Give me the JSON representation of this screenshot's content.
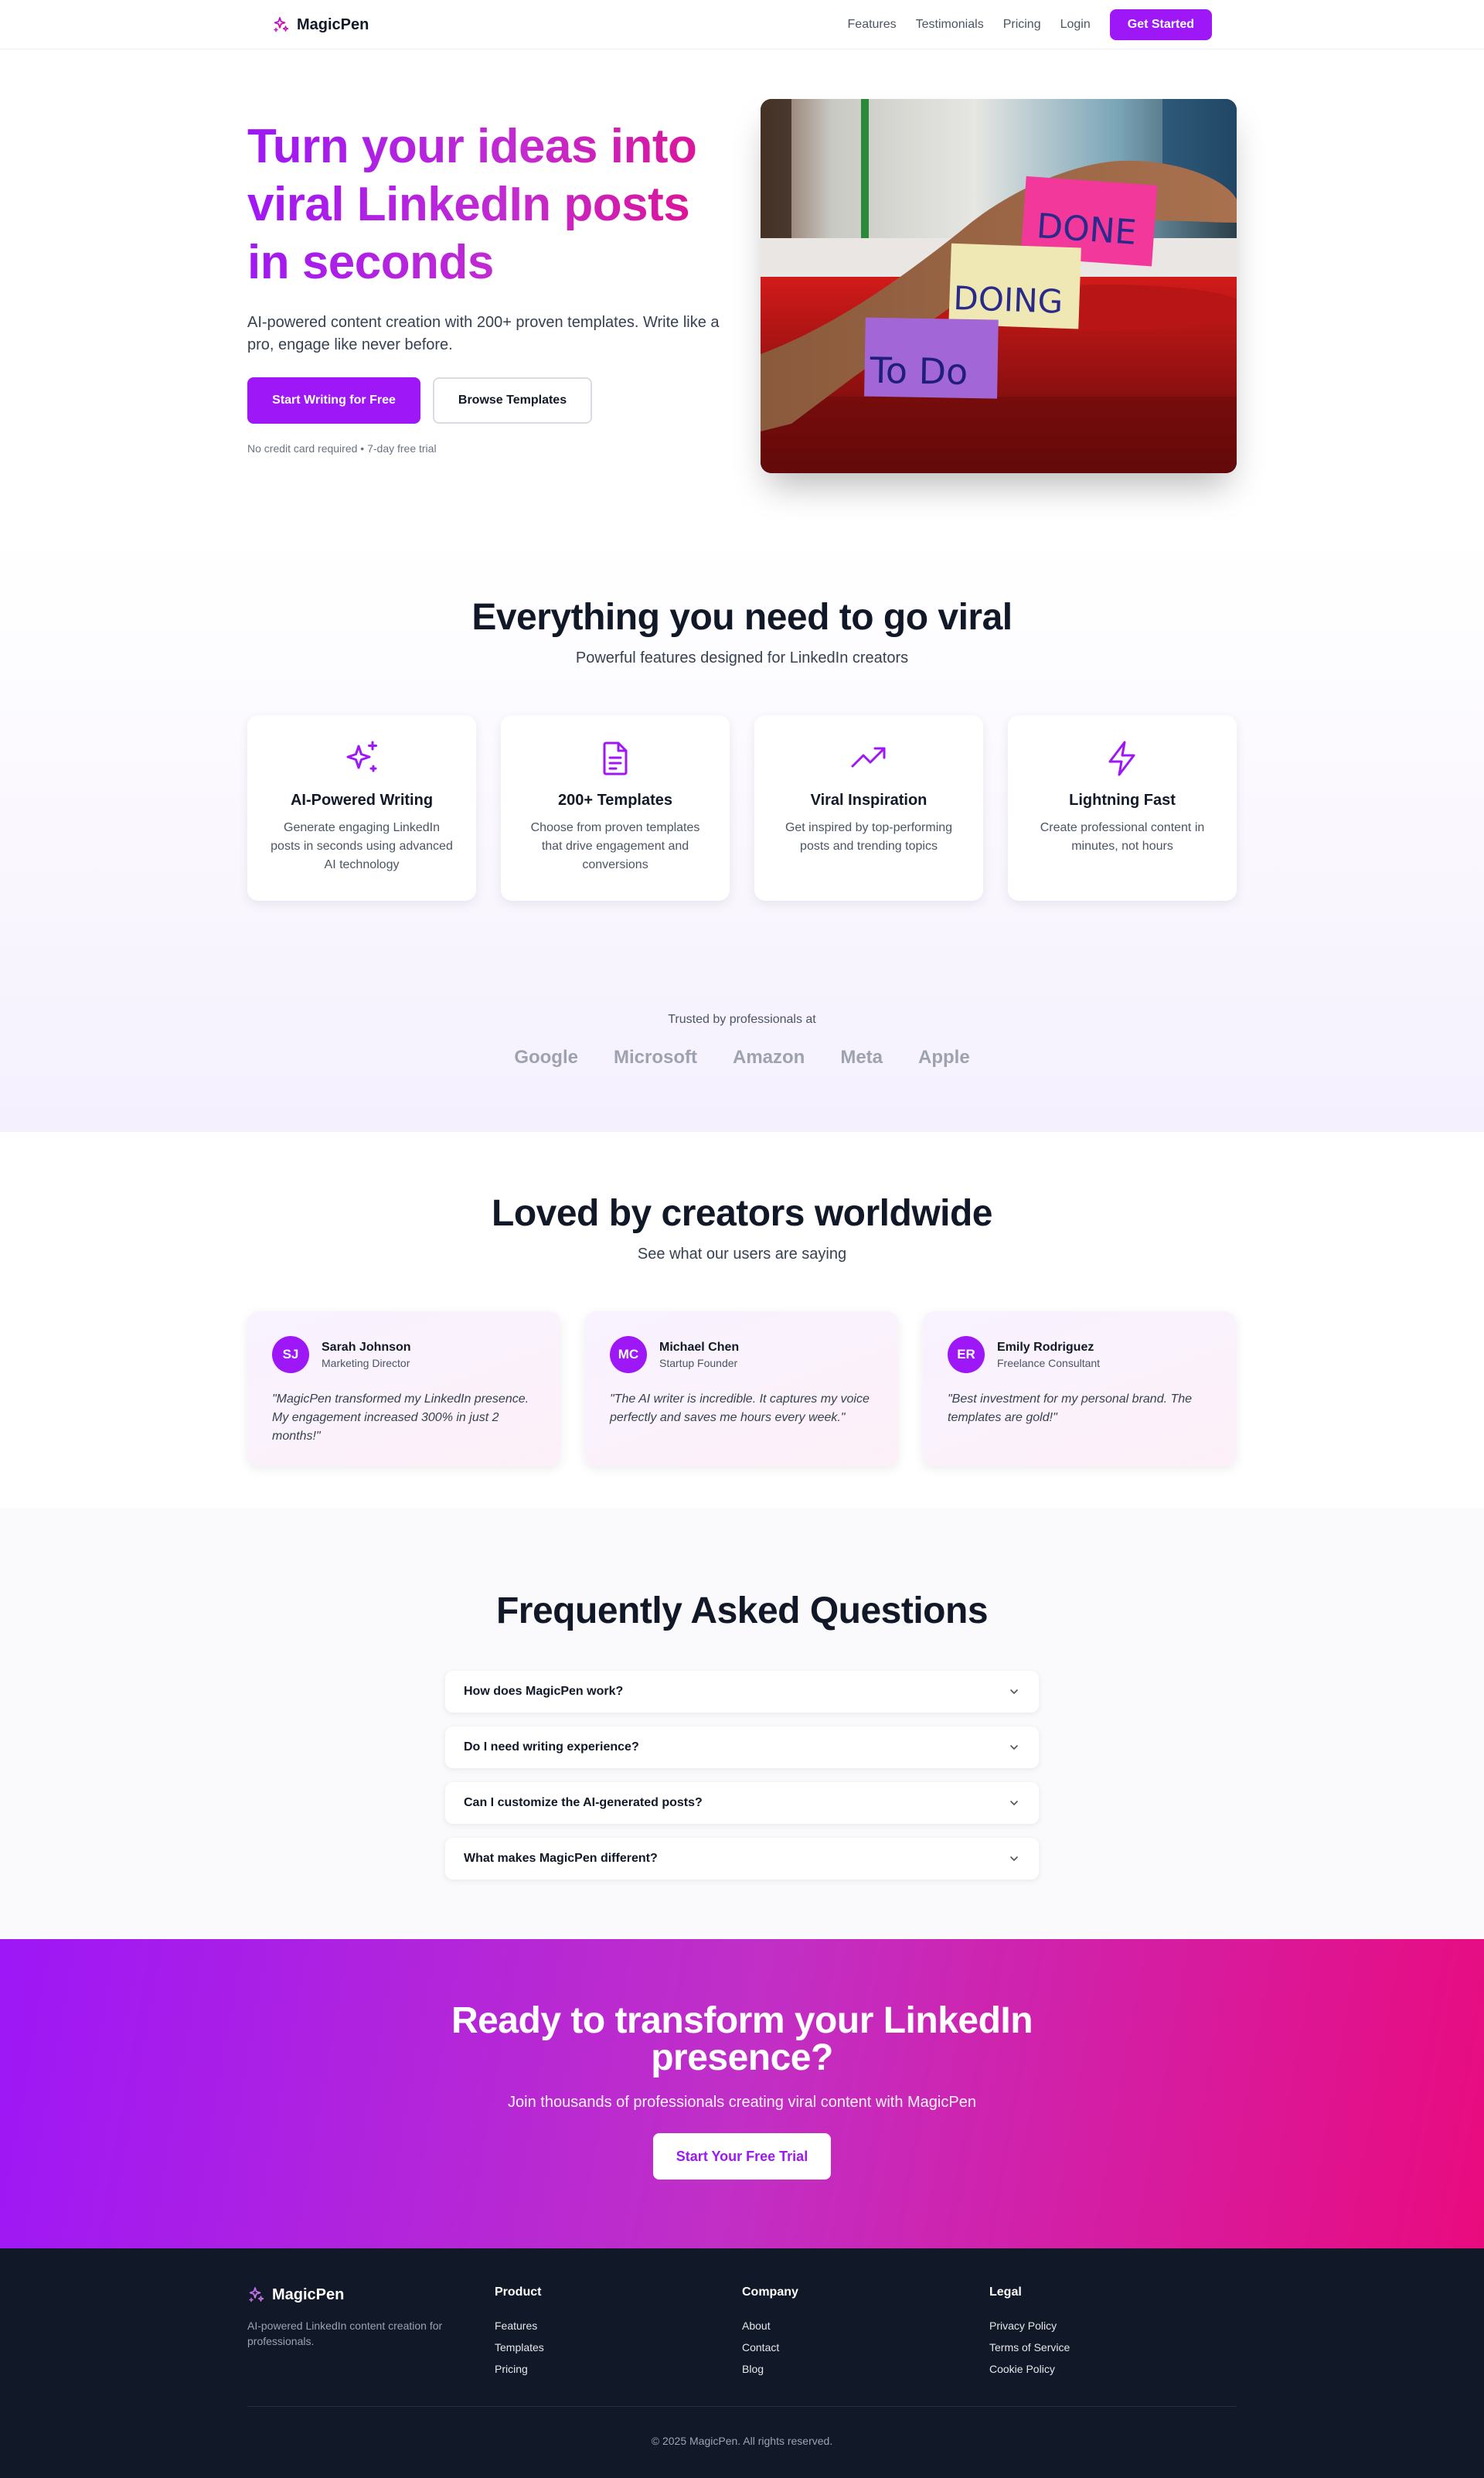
{
  "nav": {
    "brand": "MagicPen",
    "links": [
      "Features",
      "Testimonials",
      "Pricing",
      "Login"
    ],
    "cta": "Get Started"
  },
  "hero": {
    "title": "Turn your ideas into viral LinkedIn posts in seconds",
    "subtitle": "AI-powered content creation with 200+ proven templates. Write like a pro, engage like never before.",
    "primary_button": "Start Writing for Free",
    "secondary_button": "Browse Templates",
    "note": "No credit card required • 7-day free trial",
    "image_notes": [
      "Done",
      "Doing",
      "To Do"
    ]
  },
  "features": {
    "title": "Everything you need to go viral",
    "subtitle": "Powerful features designed for LinkedIn creators",
    "items": [
      {
        "icon": "sparkles-icon",
        "title": "AI-Powered Writing",
        "desc": "Generate engaging LinkedIn posts in seconds using advanced AI technology"
      },
      {
        "icon": "document-icon",
        "title": "200+ Templates",
        "desc": "Choose from proven templates that drive engagement and conversions"
      },
      {
        "icon": "trending-up-icon",
        "title": "Viral Inspiration",
        "desc": "Get inspired by top-performing posts and trending topics"
      },
      {
        "icon": "lightning-icon",
        "title": "Lightning Fast",
        "desc": "Create professional content in minutes, not hours"
      }
    ],
    "trusted_label": "Trusted by professionals at",
    "logos": [
      "Google",
      "Microsoft",
      "Amazon",
      "Meta",
      "Apple"
    ]
  },
  "testimonials": {
    "title": "Loved by creators worldwide",
    "subtitle": "See what our users are saying",
    "items": [
      {
        "initials": "SJ",
        "name": "Sarah Johnson",
        "role": "Marketing Director",
        "quote": "\"MagicPen transformed my LinkedIn presence. My engagement increased 300% in just 2 months!\""
      },
      {
        "initials": "MC",
        "name": "Michael Chen",
        "role": "Startup Founder",
        "quote": "\"The AI writer is incredible. It captures my voice perfectly and saves me hours every week.\""
      },
      {
        "initials": "ER",
        "name": "Emily Rodriguez",
        "role": "Freelance Consultant",
        "quote": "\"Best investment for my personal brand. The templates are gold!\""
      }
    ]
  },
  "faq": {
    "title": "Frequently Asked Questions",
    "questions": [
      "How does MagicPen work?",
      "Do I need writing experience?",
      "Can I customize the AI-generated posts?",
      "What makes MagicPen different?"
    ]
  },
  "cta": {
    "title": "Ready to transform your LinkedIn presence?",
    "subtitle": "Join thousands of professionals creating viral content with MagicPen",
    "button": "Start Your Free Trial"
  },
  "footer": {
    "brand": "MagicPen",
    "description": "AI-powered LinkedIn content creation for professionals.",
    "columns": [
      {
        "title": "Product",
        "links": [
          "Features",
          "Templates",
          "Pricing"
        ]
      },
      {
        "title": "Company",
        "links": [
          "About",
          "Contact",
          "Blog"
        ]
      },
      {
        "title": "Legal",
        "links": [
          "Privacy Policy",
          "Terms of Service",
          "Cookie Policy"
        ]
      }
    ],
    "copyright": "© 2025 MagicPen. All rights reserved."
  },
  "colors": {
    "accent": "#9d17f7",
    "pink": "#e90b7e",
    "footer_bg": "#111827"
  }
}
